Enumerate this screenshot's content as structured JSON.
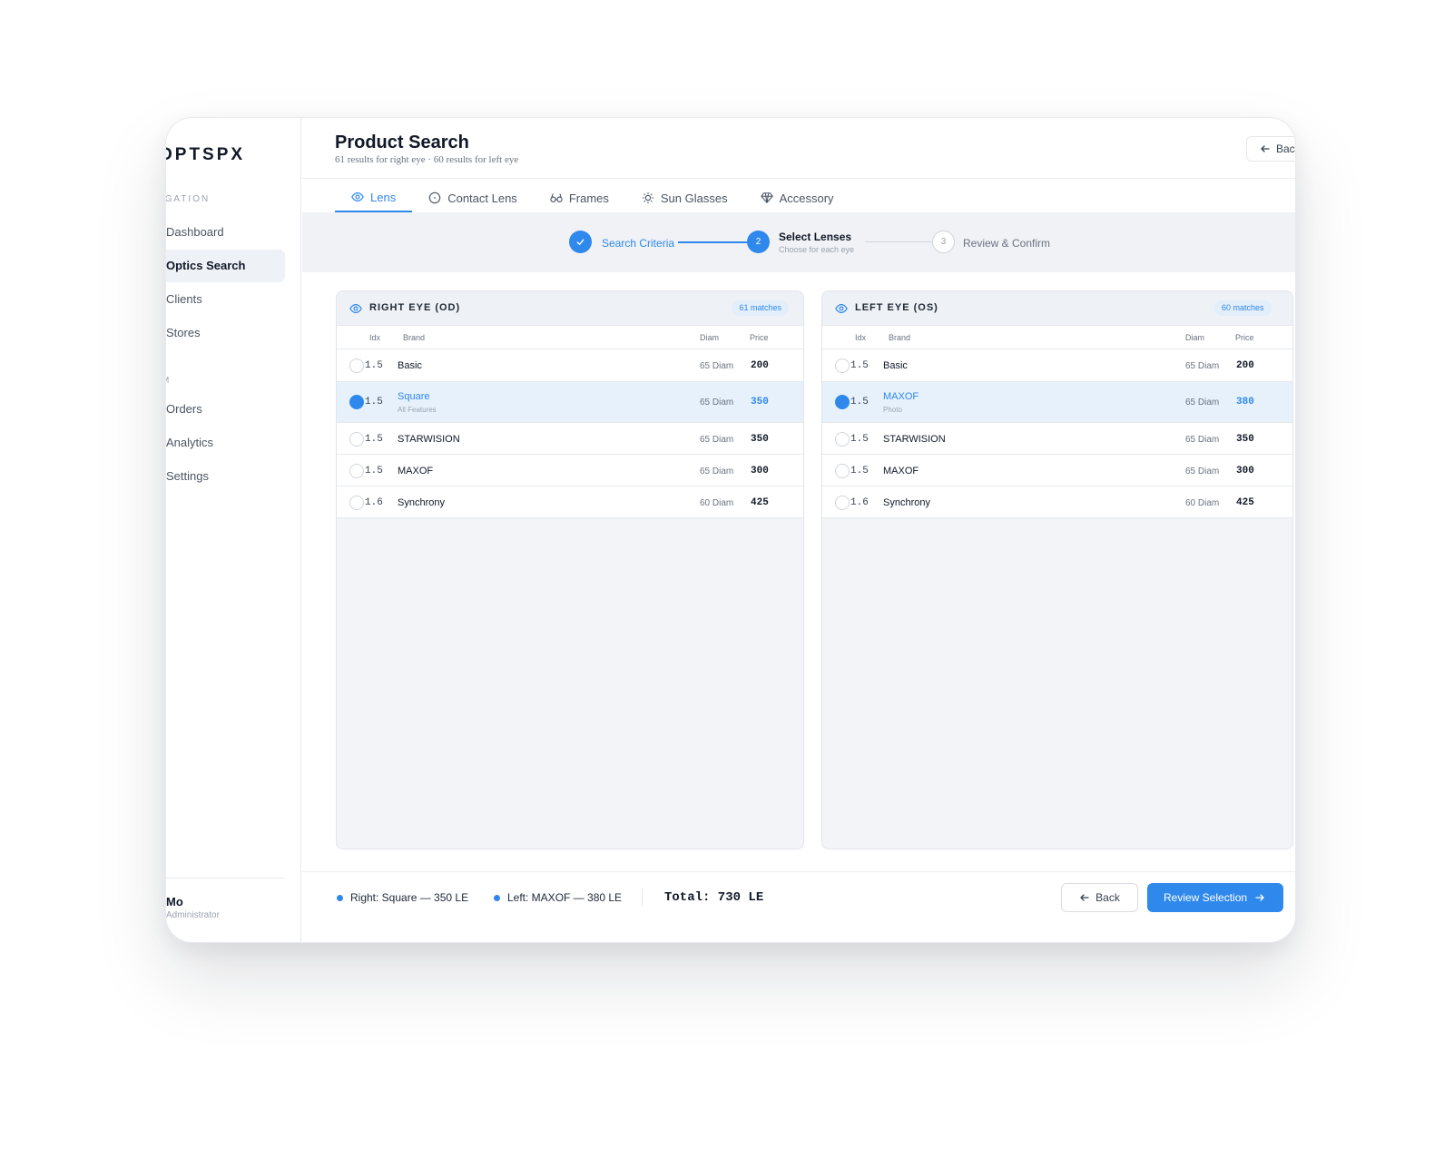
{
  "app": {
    "logo": "OPTSPX"
  },
  "sidebar": {
    "section_label": "NAVIGATION",
    "items": [
      {
        "label": "Dashboard"
      },
      {
        "label": "Optics Search"
      },
      {
        "label": "Clients"
      },
      {
        "label": "Stores"
      },
      {
        "label": "Orders"
      },
      {
        "label": "Analytics"
      },
      {
        "label": "Settings"
      }
    ],
    "section_label_2": "M",
    "user": {
      "name": "Mo",
      "role": "Administrator"
    }
  },
  "header": {
    "title": "Product Search",
    "subtitle": "61 results for right eye · 60 results for left eye",
    "back_label": "Back"
  },
  "tabs": [
    {
      "label": "Lens",
      "icon": "eye-icon"
    },
    {
      "label": "Contact Lens",
      "icon": "circle-icon"
    },
    {
      "label": "Frames",
      "icon": "glasses-icon"
    },
    {
      "label": "Sun Glasses",
      "icon": "sun-icon"
    },
    {
      "label": "Accessory",
      "icon": "diamond-icon"
    }
  ],
  "stepper": {
    "steps": [
      {
        "label": "Search Criteria",
        "state": "done"
      },
      {
        "number": "2",
        "label": "Select Lenses",
        "hint": "Choose for each eye",
        "state": "current"
      },
      {
        "number": "3",
        "label": "Review & Confirm",
        "state": "pending"
      }
    ]
  },
  "panels": {
    "columns": {
      "idx": "Idx",
      "brand": "Brand",
      "diam": "Diam",
      "price": "Price"
    },
    "right": {
      "title": "RIGHT EYE (OD)",
      "matches": "61 matches",
      "rows": [
        {
          "idx": "1.5",
          "brand": "Basic",
          "diam": "65 Diam",
          "price": "200"
        },
        {
          "idx": "1.5",
          "brand": "Square",
          "feature": "All Features",
          "diam": "65 Diam",
          "price": "350",
          "selected": true
        },
        {
          "idx": "1.5",
          "brand": "STARWISION",
          "diam": "65 Diam",
          "price": "350"
        },
        {
          "idx": "1.5",
          "brand": "MAXOF",
          "diam": "65 Diam",
          "price": "300"
        },
        {
          "idx": "1.6",
          "brand": "Synchrony",
          "diam": "60 Diam",
          "price": "425"
        }
      ]
    },
    "left": {
      "title": "LEFT EYE (OS)",
      "matches": "60 matches",
      "rows": [
        {
          "idx": "1.5",
          "brand": "Basic",
          "diam": "65 Diam",
          "price": "200"
        },
        {
          "idx": "1.5",
          "brand": "MAXOF",
          "feature": "Photo",
          "diam": "65 Diam",
          "price": "380",
          "selected": true
        },
        {
          "idx": "1.5",
          "brand": "STARWISION",
          "diam": "65 Diam",
          "price": "350"
        },
        {
          "idx": "1.5",
          "brand": "MAXOF",
          "diam": "65 Diam",
          "price": "300"
        },
        {
          "idx": "1.6",
          "brand": "Synchrony",
          "diam": "60 Diam",
          "price": "425"
        }
      ]
    }
  },
  "footer": {
    "right_summary": "Right: Square — 350 LE",
    "left_summary": "Left: MAXOF — 380 LE",
    "total": "Total: 730 LE",
    "back_label": "Back",
    "review_label": "Review Selection"
  },
  "colors": {
    "accent": "#2f88ec",
    "selected_row": "#e6f1fc"
  }
}
